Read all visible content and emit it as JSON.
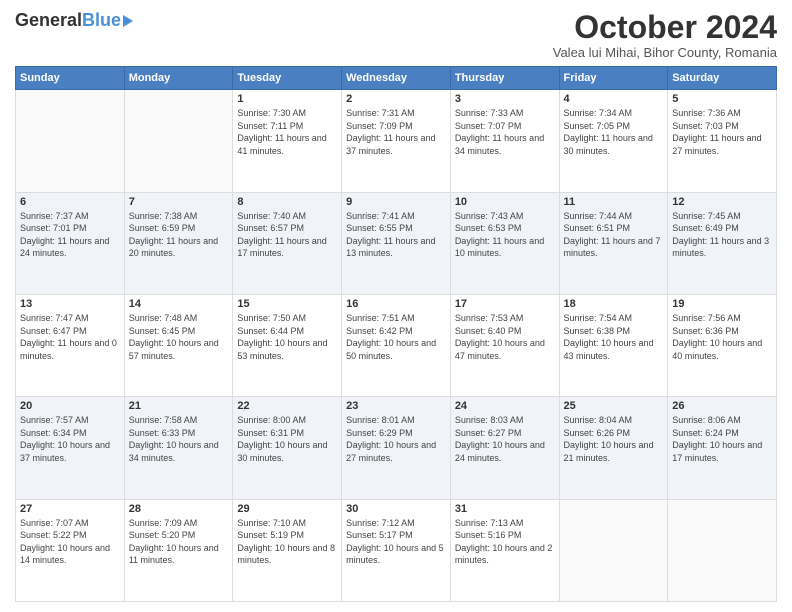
{
  "logo": {
    "general": "General",
    "blue": "Blue"
  },
  "header": {
    "month": "October 2024",
    "location": "Valea lui Mihai, Bihor County, Romania"
  },
  "weekdays": [
    "Sunday",
    "Monday",
    "Tuesday",
    "Wednesday",
    "Thursday",
    "Friday",
    "Saturday"
  ],
  "weeks": [
    [
      {
        "day": "",
        "info": ""
      },
      {
        "day": "",
        "info": ""
      },
      {
        "day": "1",
        "info": "Sunrise: 7:30 AM\nSunset: 7:11 PM\nDaylight: 11 hours and 41 minutes."
      },
      {
        "day": "2",
        "info": "Sunrise: 7:31 AM\nSunset: 7:09 PM\nDaylight: 11 hours and 37 minutes."
      },
      {
        "day": "3",
        "info": "Sunrise: 7:33 AM\nSunset: 7:07 PM\nDaylight: 11 hours and 34 minutes."
      },
      {
        "day": "4",
        "info": "Sunrise: 7:34 AM\nSunset: 7:05 PM\nDaylight: 11 hours and 30 minutes."
      },
      {
        "day": "5",
        "info": "Sunrise: 7:36 AM\nSunset: 7:03 PM\nDaylight: 11 hours and 27 minutes."
      }
    ],
    [
      {
        "day": "6",
        "info": "Sunrise: 7:37 AM\nSunset: 7:01 PM\nDaylight: 11 hours and 24 minutes."
      },
      {
        "day": "7",
        "info": "Sunrise: 7:38 AM\nSunset: 6:59 PM\nDaylight: 11 hours and 20 minutes."
      },
      {
        "day": "8",
        "info": "Sunrise: 7:40 AM\nSunset: 6:57 PM\nDaylight: 11 hours and 17 minutes."
      },
      {
        "day": "9",
        "info": "Sunrise: 7:41 AM\nSunset: 6:55 PM\nDaylight: 11 hours and 13 minutes."
      },
      {
        "day": "10",
        "info": "Sunrise: 7:43 AM\nSunset: 6:53 PM\nDaylight: 11 hours and 10 minutes."
      },
      {
        "day": "11",
        "info": "Sunrise: 7:44 AM\nSunset: 6:51 PM\nDaylight: 11 hours and 7 minutes."
      },
      {
        "day": "12",
        "info": "Sunrise: 7:45 AM\nSunset: 6:49 PM\nDaylight: 11 hours and 3 minutes."
      }
    ],
    [
      {
        "day": "13",
        "info": "Sunrise: 7:47 AM\nSunset: 6:47 PM\nDaylight: 11 hours and 0 minutes."
      },
      {
        "day": "14",
        "info": "Sunrise: 7:48 AM\nSunset: 6:45 PM\nDaylight: 10 hours and 57 minutes."
      },
      {
        "day": "15",
        "info": "Sunrise: 7:50 AM\nSunset: 6:44 PM\nDaylight: 10 hours and 53 minutes."
      },
      {
        "day": "16",
        "info": "Sunrise: 7:51 AM\nSunset: 6:42 PM\nDaylight: 10 hours and 50 minutes."
      },
      {
        "day": "17",
        "info": "Sunrise: 7:53 AM\nSunset: 6:40 PM\nDaylight: 10 hours and 47 minutes."
      },
      {
        "day": "18",
        "info": "Sunrise: 7:54 AM\nSunset: 6:38 PM\nDaylight: 10 hours and 43 minutes."
      },
      {
        "day": "19",
        "info": "Sunrise: 7:56 AM\nSunset: 6:36 PM\nDaylight: 10 hours and 40 minutes."
      }
    ],
    [
      {
        "day": "20",
        "info": "Sunrise: 7:57 AM\nSunset: 6:34 PM\nDaylight: 10 hours and 37 minutes."
      },
      {
        "day": "21",
        "info": "Sunrise: 7:58 AM\nSunset: 6:33 PM\nDaylight: 10 hours and 34 minutes."
      },
      {
        "day": "22",
        "info": "Sunrise: 8:00 AM\nSunset: 6:31 PM\nDaylight: 10 hours and 30 minutes."
      },
      {
        "day": "23",
        "info": "Sunrise: 8:01 AM\nSunset: 6:29 PM\nDaylight: 10 hours and 27 minutes."
      },
      {
        "day": "24",
        "info": "Sunrise: 8:03 AM\nSunset: 6:27 PM\nDaylight: 10 hours and 24 minutes."
      },
      {
        "day": "25",
        "info": "Sunrise: 8:04 AM\nSunset: 6:26 PM\nDaylight: 10 hours and 21 minutes."
      },
      {
        "day": "26",
        "info": "Sunrise: 8:06 AM\nSunset: 6:24 PM\nDaylight: 10 hours and 17 minutes."
      }
    ],
    [
      {
        "day": "27",
        "info": "Sunrise: 7:07 AM\nSunset: 5:22 PM\nDaylight: 10 hours and 14 minutes."
      },
      {
        "day": "28",
        "info": "Sunrise: 7:09 AM\nSunset: 5:20 PM\nDaylight: 10 hours and 11 minutes."
      },
      {
        "day": "29",
        "info": "Sunrise: 7:10 AM\nSunset: 5:19 PM\nDaylight: 10 hours and 8 minutes."
      },
      {
        "day": "30",
        "info": "Sunrise: 7:12 AM\nSunset: 5:17 PM\nDaylight: 10 hours and 5 minutes."
      },
      {
        "day": "31",
        "info": "Sunrise: 7:13 AM\nSunset: 5:16 PM\nDaylight: 10 hours and 2 minutes."
      },
      {
        "day": "",
        "info": ""
      },
      {
        "day": "",
        "info": ""
      }
    ]
  ]
}
